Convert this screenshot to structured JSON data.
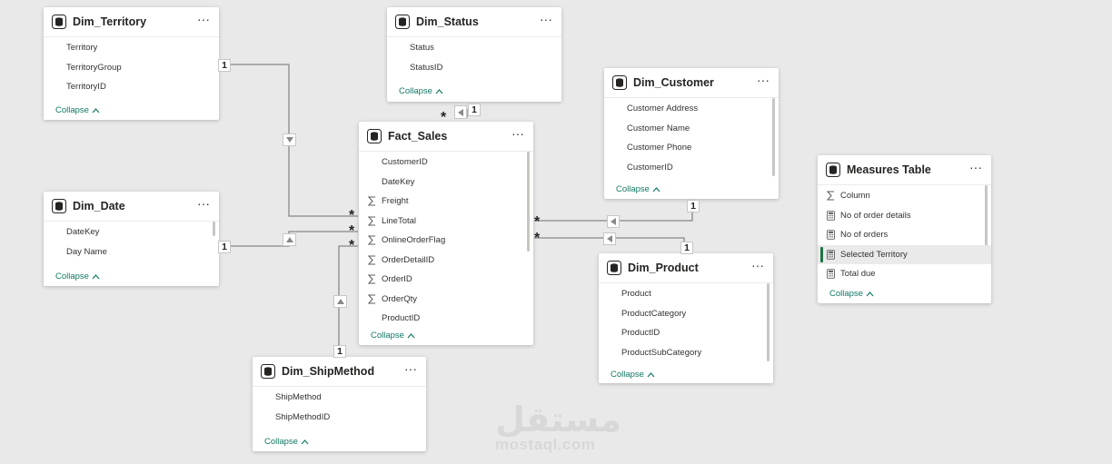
{
  "collapse_label": "Collapse",
  "tables": {
    "territory": {
      "name": "Dim_Territory",
      "more": "···",
      "fields": [
        {
          "label": "Territory",
          "icon": "none"
        },
        {
          "label": "TerritoryGroup",
          "icon": "none"
        },
        {
          "label": "TerritoryID",
          "icon": "none"
        }
      ]
    },
    "status": {
      "name": "Dim_Status",
      "more": "···",
      "fields": [
        {
          "label": "Status",
          "icon": "none"
        },
        {
          "label": "StatusID",
          "icon": "none"
        }
      ]
    },
    "customer": {
      "name": "Dim_Customer",
      "more": "···",
      "fields": [
        {
          "label": "Customer Address",
          "icon": "none"
        },
        {
          "label": "Customer Name",
          "icon": "none"
        },
        {
          "label": "Customer Phone",
          "icon": "none"
        },
        {
          "label": "CustomerID",
          "icon": "none"
        }
      ]
    },
    "sales": {
      "name": "Fact_Sales",
      "more": "···",
      "fields": [
        {
          "label": "CustomerID",
          "icon": "none"
        },
        {
          "label": "DateKey",
          "icon": "none"
        },
        {
          "label": "Freight",
          "icon": "sigma"
        },
        {
          "label": "LineTotal",
          "icon": "sigma"
        },
        {
          "label": "OnlineOrderFlag",
          "icon": "sigma"
        },
        {
          "label": "OrderDetailID",
          "icon": "sigma"
        },
        {
          "label": "OrderID",
          "icon": "sigma"
        },
        {
          "label": "OrderQty",
          "icon": "sigma"
        },
        {
          "label": "ProductID",
          "icon": "none"
        }
      ]
    },
    "date": {
      "name": "Dim_Date",
      "more": "···",
      "fields": [
        {
          "label": "DateKey",
          "icon": "none"
        },
        {
          "label": "Day Name",
          "icon": "none"
        }
      ]
    },
    "measures": {
      "name": "Measures Table",
      "more": "···",
      "fields": [
        {
          "label": "Column",
          "icon": "sigma"
        },
        {
          "label": "No of order details",
          "icon": "calculator"
        },
        {
          "label": "No of orders",
          "icon": "calculator"
        },
        {
          "label": "Selected Territory",
          "icon": "calculator",
          "selected": true
        },
        {
          "label": "Total due",
          "icon": "calculator"
        }
      ]
    },
    "product": {
      "name": "Dim_Product",
      "more": "···",
      "fields": [
        {
          "label": "Product",
          "icon": "none"
        },
        {
          "label": "ProductCategory",
          "icon": "none"
        },
        {
          "label": "ProductID",
          "icon": "none"
        },
        {
          "label": "ProductSubCategory",
          "icon": "none"
        }
      ]
    },
    "shipmethod": {
      "name": "Dim_ShipMethod",
      "more": "···",
      "fields": [
        {
          "label": "ShipMethod",
          "icon": "none"
        },
        {
          "label": "ShipMethodID",
          "icon": "none"
        }
      ]
    }
  },
  "relationships": [
    {
      "from": "Dim_Territory",
      "to": "Fact_Sales",
      "one": "1",
      "many": "*"
    },
    {
      "from": "Dim_Status",
      "to": "Fact_Sales",
      "one": "1",
      "many": "*"
    },
    {
      "from": "Dim_Customer",
      "to": "Fact_Sales",
      "one": "1",
      "many": "*"
    },
    {
      "from": "Dim_Date",
      "to": "Fact_Sales",
      "one": "1",
      "many": "*"
    },
    {
      "from": "Dim_Product",
      "to": "Fact_Sales",
      "one": "1",
      "many": "*"
    },
    {
      "from": "Dim_ShipMethod",
      "to": "Fact_Sales",
      "one": "1",
      "many": "*"
    }
  ],
  "watermark": {
    "arabic": "مستقل",
    "latin": "mostaql.com"
  },
  "colors": {
    "canvas": "#e9e9e9",
    "accent": "#117865",
    "selected_bar": "#217346",
    "line": "#8a8886"
  }
}
